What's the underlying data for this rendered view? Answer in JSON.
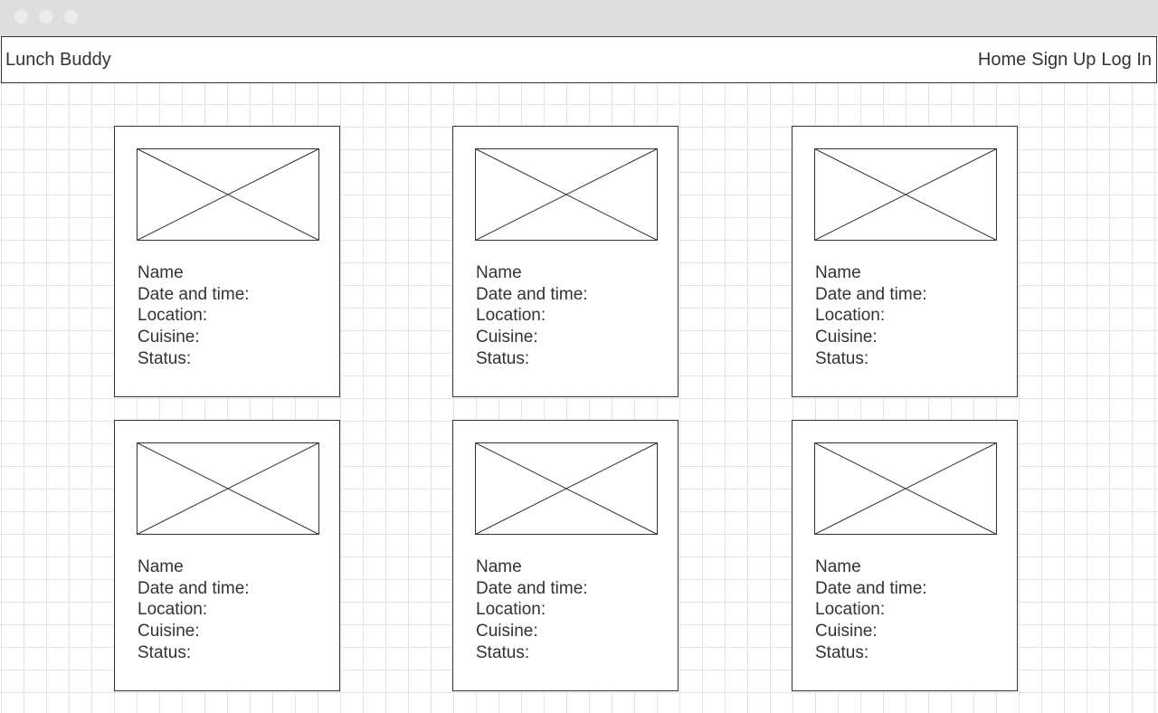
{
  "navbar": {
    "brand": "Lunch Buddy",
    "links": [
      "Home",
      "Sign Up",
      "Log In"
    ]
  },
  "cards": [
    {
      "name": "Name",
      "date_time": "Date and time:",
      "location": "Location:",
      "cuisine": "Cuisine:",
      "status": "Status:"
    },
    {
      "name": "Name",
      "date_time": "Date and time:",
      "location": "Location:",
      "cuisine": "Cuisine:",
      "status": "Status:"
    },
    {
      "name": "Name",
      "date_time": "Date and time:",
      "location": "Location:",
      "cuisine": "Cuisine:",
      "status": "Status:"
    },
    {
      "name": "Name",
      "date_time": "Date and time:",
      "location": "Location:",
      "cuisine": "Cuisine:",
      "status": "Status:"
    },
    {
      "name": "Name",
      "date_time": "Date and time:",
      "location": "Location:",
      "cuisine": "Cuisine:",
      "status": "Status:"
    },
    {
      "name": "Name",
      "date_time": "Date and time:",
      "location": "Location:",
      "cuisine": "Cuisine:",
      "status": "Status:"
    }
  ],
  "icons": {
    "card_image": "image-placeholder-icon"
  },
  "colors": {
    "line": "#333333",
    "grid": "#e4e4e4",
    "titlebar": "#dedede"
  }
}
